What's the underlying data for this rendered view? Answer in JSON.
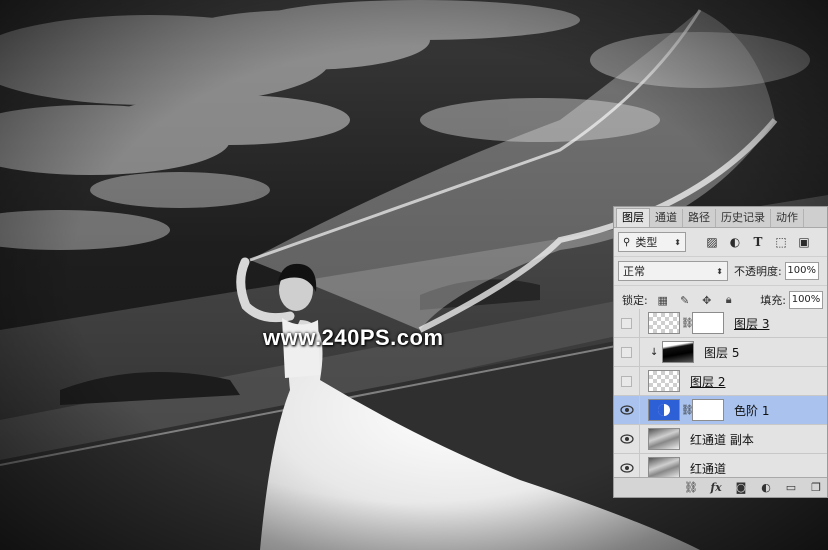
{
  "watermark": "www.240PS.com",
  "panel": {
    "tabs": [
      {
        "label": "图层",
        "active": true
      },
      {
        "label": "通道",
        "active": false
      },
      {
        "label": "路径",
        "active": false
      },
      {
        "label": "历史记录",
        "active": false
      },
      {
        "label": "动作",
        "active": false
      }
    ],
    "filter": {
      "label": "类型",
      "icon": "search-icon"
    },
    "blend_mode": "正常",
    "opacity": {
      "label": "不透明度:",
      "value": "100%"
    },
    "lock": {
      "label": "锁定:"
    },
    "fill": {
      "label": "填充:",
      "value": "100%"
    },
    "layers": [
      {
        "name": "图层 3",
        "visible": false,
        "thumb": "transparent",
        "mask": true,
        "selected": false,
        "clipped": false
      },
      {
        "name": "图层 5",
        "visible": false,
        "thumb": "dark",
        "mask": false,
        "selected": false,
        "clipped": true
      },
      {
        "name": "图层 2",
        "visible": false,
        "thumb": "transparent",
        "mask": false,
        "selected": false,
        "clipped": false
      },
      {
        "name": "色阶 1",
        "visible": true,
        "thumb": "adjust",
        "mask": true,
        "selected": true,
        "clipped": false
      },
      {
        "name": "红通道 副本",
        "visible": true,
        "thumb": "photo",
        "mask": false,
        "selected": false,
        "clipped": false
      },
      {
        "name": "红通道",
        "visible": true,
        "thumb": "photo",
        "mask": false,
        "selected": false,
        "clipped": false
      }
    ],
    "colors": {
      "selected_row": "#a9c3ee",
      "adjust_icon": "#2d5fd7"
    }
  }
}
